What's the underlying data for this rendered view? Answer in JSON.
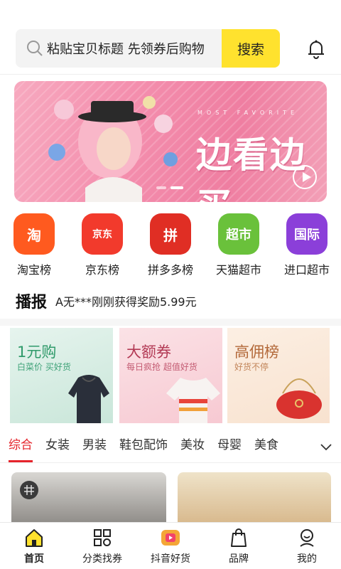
{
  "header": {
    "search_placeholder": "粘贴宝贝标题 先领券后购物",
    "search_button": "搜索"
  },
  "banner": {
    "small_title": "MOST FAVORITE",
    "big_title": "边看边买"
  },
  "categories": [
    {
      "label": "淘宝榜",
      "icon_text": "淘",
      "color": "#ff5a1f"
    },
    {
      "label": "京东榜",
      "icon_text": "京东",
      "color": "#f23a2c"
    },
    {
      "label": "拼多多榜",
      "icon_text": "拼",
      "color": "#e02e24"
    },
    {
      "label": "天猫超市",
      "icon_text": "超市",
      "color": "#6ac13b"
    },
    {
      "label": "进口超市",
      "icon_text": "国际",
      "color": "#8b3fd9"
    }
  ],
  "broadcast": {
    "title": "播报",
    "text": "A无***刚刚获得奖励5.99元"
  },
  "promos": [
    {
      "title": "1元购",
      "subtitle": "白菜价 买好货"
    },
    {
      "title": "大额券",
      "subtitle": "每日疯抢 超值好货"
    },
    {
      "title": "高佣榜",
      "subtitle": "好货不停"
    }
  ],
  "tabs": [
    "综合",
    "女装",
    "男装",
    "鞋包配饰",
    "美妆",
    "母婴",
    "美食"
  ],
  "bottom_nav": [
    {
      "label": "首页",
      "icon": "home-icon"
    },
    {
      "label": "分类找券",
      "icon": "grid-icon"
    },
    {
      "label": "抖音好货",
      "icon": "video-icon"
    },
    {
      "label": "品牌",
      "icon": "brand-bag-icon"
    },
    {
      "label": "我的",
      "icon": "user-icon"
    }
  ],
  "colors": {
    "accent_yellow": "#ffe22e",
    "active_red": "#e5242b",
    "banner_pink": "#f48fae"
  }
}
